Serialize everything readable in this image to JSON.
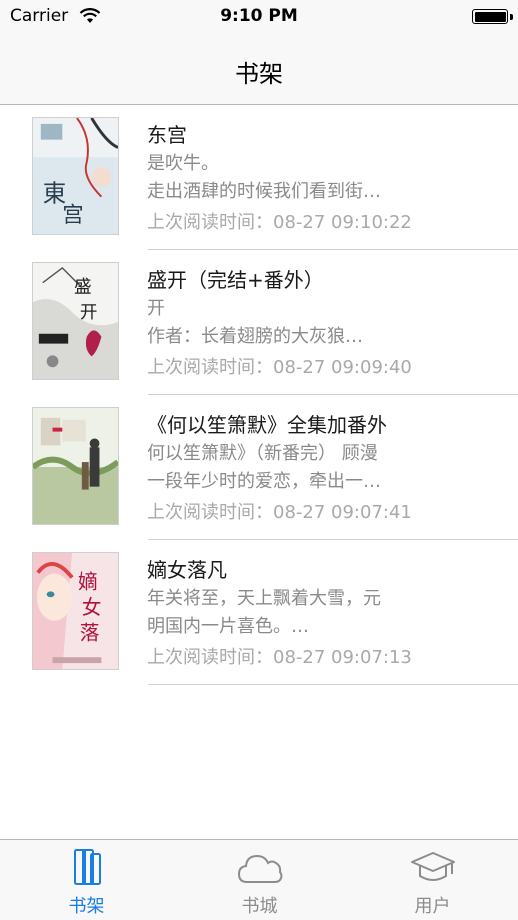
{
  "status_bar": {
    "carrier": "Carrier",
    "time": "9:10 PM"
  },
  "nav": {
    "title": "书架"
  },
  "books": [
    {
      "title": "东宫",
      "snippet_line1": "是吹牛。",
      "snippet_line2": "        走出酒肆的时候我们看到街…",
      "last_read": "上次阅读时间：08-27 09:10:22"
    },
    {
      "title": "盛开（完结+番外）",
      "snippet_line1": "开",
      "snippet_line2": "        作者：长着翅膀的大灰狼…",
      "last_read": "上次阅读时间：08-27 09:09:40"
    },
    {
      "title": "《何以笙箫默》全集加番外",
      "snippet_line1": "何以笙箫默》（新番完） 顾漫",
      "snippet_line2": "        一段年少时的爱恋，牵出一…",
      "last_read": "上次阅读时间：08-27 09:07:41"
    },
    {
      "title": "嫡女落凡",
      "snippet_line1": "      年关将至，天上飘着大雪，元",
      "snippet_line2": "明国内一片喜色。…",
      "last_read": "上次阅读时间：08-27 09:07:13"
    }
  ],
  "tabs": [
    {
      "label": "书架",
      "icon": "bookshelf-icon",
      "active": true
    },
    {
      "label": "书城",
      "icon": "cloud-icon",
      "active": false
    },
    {
      "label": "用户",
      "icon": "graduation-cap-icon",
      "active": false
    }
  ],
  "colors": {
    "accent": "#1a7de6",
    "tab_inactive": "#8c8c8c",
    "snippet": "#8a8a8a"
  }
}
